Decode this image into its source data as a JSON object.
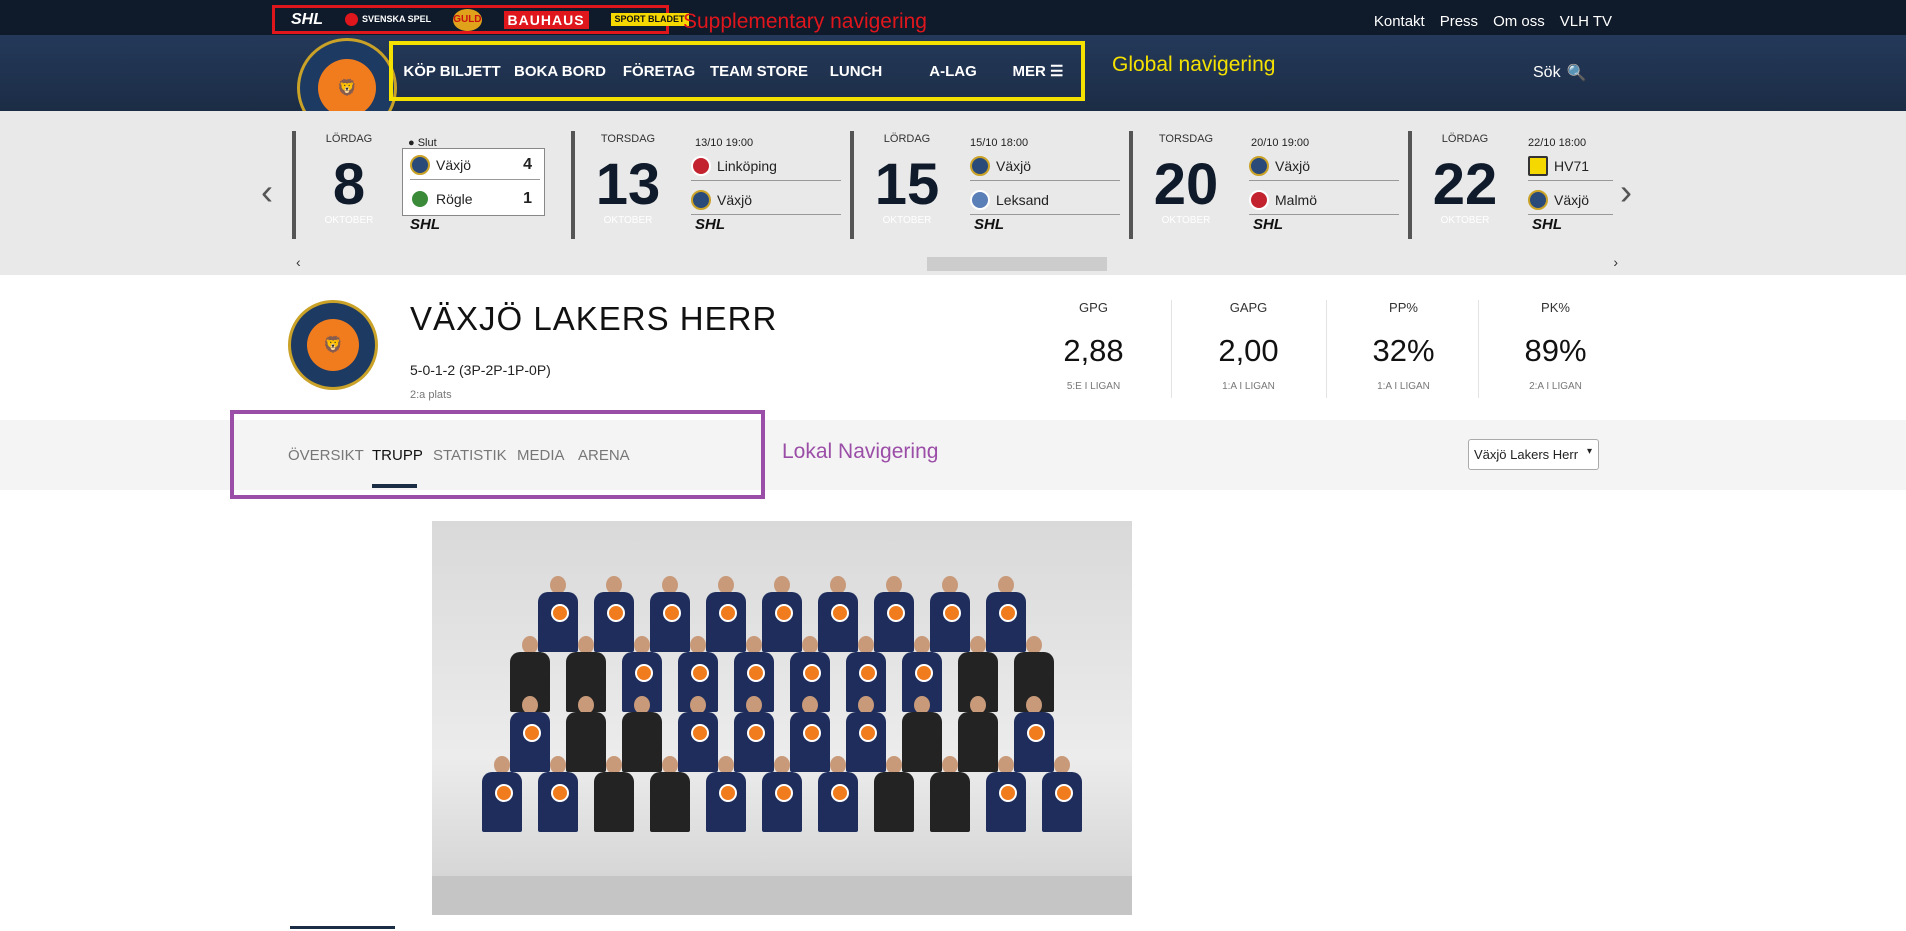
{
  "annotations": {
    "supplementary": "Supplementary navigering",
    "global": "Global navigering",
    "local": "Lokal Navigering"
  },
  "sponsors": [
    "SHL",
    "SVENSKA SPEL",
    "GULD",
    "BAUHAUS",
    "SPORT BLADET"
  ],
  "top_links": [
    "Kontakt",
    "Press",
    "Om oss",
    "VLH TV"
  ],
  "global_nav": {
    "items": [
      "KÖP BILJETT",
      "BOKA BORD",
      "FÖRETAG",
      "TEAM STORE",
      "LUNCH",
      "A-LAG",
      "MER"
    ],
    "search_label": "Sök"
  },
  "games": [
    {
      "dow": "LÖRDAG",
      "day": "8",
      "month": "OKTOBER",
      "meta": "● Slut",
      "home": "Växjö",
      "away": "Rögle",
      "home_score": "4",
      "away_score": "1",
      "league": "SHL"
    },
    {
      "dow": "TORSDAG",
      "day": "13",
      "month": "OKTOBER",
      "meta": "13/10 19:00",
      "home": "Linköping",
      "away": "Växjö",
      "league": "SHL"
    },
    {
      "dow": "LÖRDAG",
      "day": "15",
      "month": "OKTOBER",
      "meta": "15/10 18:00",
      "home": "Växjö",
      "away": "Leksand",
      "league": "SHL"
    },
    {
      "dow": "TORSDAG",
      "day": "20",
      "month": "OKTOBER",
      "meta": "20/10 19:00",
      "home": "Växjö",
      "away": "Malmö",
      "league": "SHL"
    },
    {
      "dow": "LÖRDAG",
      "day": "22",
      "month": "OKTOBER",
      "meta": "22/10 18:00",
      "home": "HV71",
      "away": "Växjö",
      "league": "SHL"
    }
  ],
  "team": {
    "name": "VÄXJÖ LAKERS HERR",
    "record": "5-0-1-2 (3P-2P-1P-0P)",
    "place": "2:a plats"
  },
  "stats": [
    {
      "label": "GPG",
      "value": "2,88",
      "rank": "5:E I LIGAN"
    },
    {
      "label": "GAPG",
      "value": "2,00",
      "rank": "1:A I LIGAN"
    },
    {
      "label": "PP%",
      "value": "32%",
      "rank": "1:A I LIGAN"
    },
    {
      "label": "PK%",
      "value": "89%",
      "rank": "2:A I LIGAN"
    }
  ],
  "local_nav": {
    "tabs": [
      "ÖVERSIKT",
      "TRUPP",
      "STATISTIK",
      "MEDIA",
      "ARENA"
    ],
    "active": "TRUPP",
    "team_select": "Växjö Lakers Herr"
  }
}
